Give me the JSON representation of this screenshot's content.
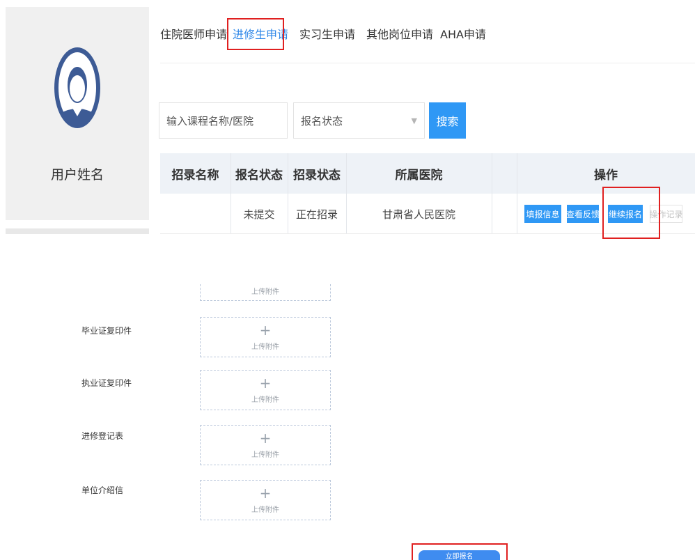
{
  "profile": {
    "user_name": "用户姓名"
  },
  "tabs": [
    {
      "label": "住院医师申请",
      "active": false
    },
    {
      "label": "进修生申请",
      "active": true
    },
    {
      "label": "实习生申请",
      "active": false
    },
    {
      "label": "其他岗位申请",
      "active": false
    },
    {
      "label": "AHA申请",
      "active": false
    }
  ],
  "filters": {
    "search_value": "输入课程名称/医院",
    "status_select_value": "报名状态",
    "search_button": "搜索"
  },
  "table": {
    "headers": [
      "招录名称",
      "报名状态",
      "招录状态",
      "所属医院",
      "操作"
    ],
    "rows": [
      {
        "name": "",
        "apply_status": "未提交",
        "recruit_status": "正在招录",
        "hospital": "甘肃省人民医院",
        "actions": [
          "填报信息",
          "查看反馈",
          "继续报名",
          "操作记录"
        ]
      }
    ]
  },
  "upload": {
    "fields": [
      {
        "label": "",
        "upload_text": "上传附件"
      },
      {
        "label": "毕业证复印件",
        "upload_text": "上传附件"
      },
      {
        "label": "执业证复印件",
        "upload_text": "上传附件"
      },
      {
        "label": "进修登记表",
        "upload_text": "上传附件"
      },
      {
        "label": "单位介绍信",
        "upload_text": "上传附件"
      }
    ],
    "plus_symbol": "+",
    "submit_button": "立即报名"
  },
  "colors": {
    "accent": "#2f98f5",
    "active_tab": "#2f87e8",
    "highlight": "#e02020",
    "table_header_bg": "#eef2f7",
    "sidebar_bg": "#f0f0f0"
  }
}
